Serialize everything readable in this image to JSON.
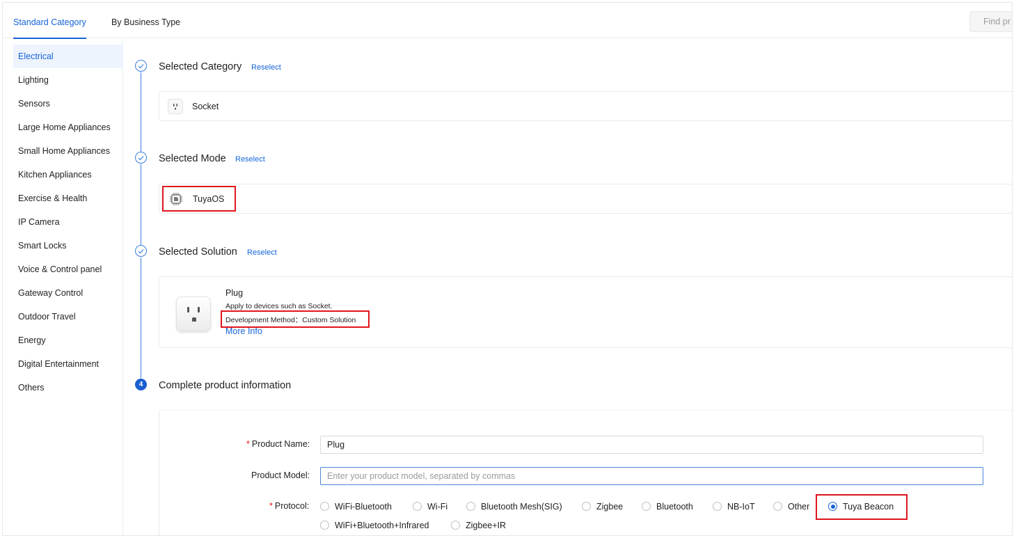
{
  "tabs": [
    {
      "label": "Standard Category",
      "active": true
    },
    {
      "label": "By Business Type",
      "active": false
    }
  ],
  "find_button": {
    "label": "Find pr"
  },
  "sidebar": {
    "items": [
      {
        "label": "Electrical",
        "active": true
      },
      {
        "label": "Lighting"
      },
      {
        "label": "Sensors"
      },
      {
        "label": "Large Home Appliances"
      },
      {
        "label": "Small Home Appliances"
      },
      {
        "label": "Kitchen Appliances"
      },
      {
        "label": "Exercise & Health"
      },
      {
        "label": "IP Camera"
      },
      {
        "label": "Smart Locks"
      },
      {
        "label": "Voice & Control panel"
      },
      {
        "label": "Gateway Control"
      },
      {
        "label": "Outdoor Travel"
      },
      {
        "label": "Energy"
      },
      {
        "label": "Digital Entertainment"
      },
      {
        "label": "Others"
      }
    ]
  },
  "steps": {
    "category": {
      "title": "Selected Category",
      "reselect": "Reselect",
      "value": "Socket",
      "icon": "socket-icon"
    },
    "mode": {
      "title": "Selected Mode",
      "reselect": "Reselect",
      "value": "TuyaOS",
      "icon": "chip-icon"
    },
    "solution": {
      "title": "Selected Solution",
      "reselect": "Reselect",
      "name": "Plug",
      "description": "Apply to devices such as Socket.",
      "dev_method": "Development Method：Custom Solution",
      "more_info": "More Info",
      "icon": "plug-icon"
    },
    "complete": {
      "number": "4",
      "title": "Complete product information"
    }
  },
  "form": {
    "product_name": {
      "label": "Product Name",
      "required": "*",
      "value": "Plug"
    },
    "product_model": {
      "label": "Product Model",
      "placeholder": "Enter your product model, separated by commas",
      "value": ""
    },
    "protocol": {
      "label": "Protocol",
      "required": "*",
      "options": [
        {
          "label": "WiFi-Bluetooth"
        },
        {
          "label": "Wi-Fi"
        },
        {
          "label": "Bluetooth Mesh(SIG)"
        },
        {
          "label": "Zigbee"
        },
        {
          "label": "Bluetooth"
        },
        {
          "label": "NB-IoT"
        },
        {
          "label": "Other"
        },
        {
          "label": "Tuya Beacon",
          "selected": true
        },
        {
          "label": "WiFi+Bluetooth+Infrared"
        },
        {
          "label": "Zigbee+IR"
        }
      ]
    }
  },
  "colors": {
    "accent": "#1464d8",
    "highlight_box": "#e0151d",
    "active_bg": "#eef4fd"
  }
}
